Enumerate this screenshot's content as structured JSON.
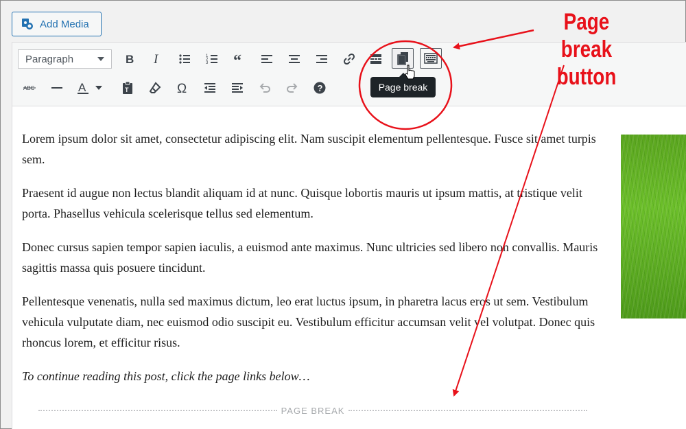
{
  "add_media": {
    "label": "Add Media",
    "icon": "media-icon"
  },
  "toolbar": {
    "format_select": "Paragraph",
    "tooltip": "Page break",
    "row1": [
      "bold-icon",
      "italic-icon",
      "bullet-list-icon",
      "numbered-list-icon",
      "blockquote-icon",
      "align-left-icon",
      "align-center-icon",
      "align-right-icon",
      "link-icon",
      "read-more-icon",
      "page-break-icon",
      "toolbar-toggle-icon"
    ],
    "row2": [
      "strikethrough-icon",
      "horizontal-line-icon",
      "text-color-icon",
      "paste-text-icon",
      "clear-formatting-icon",
      "special-character-icon",
      "outdent-icon",
      "indent-icon",
      "undo-icon",
      "redo-icon",
      "help-icon"
    ],
    "strike_label": "ABC",
    "color_label": "A",
    "omega_label": "Ω"
  },
  "content": {
    "p1": "Lorem ipsum dolor sit amet, consectetur adipiscing elit. Nam suscipit elementum pellentesque. Fusce sit amet turpis sem.",
    "p2": "Praesent id augue non lectus blandit aliquam id at nunc. Quisque lobortis mauris ut ipsum mattis, at tristique velit porta. Phasellus vehicula scelerisque tellus sed elementum.",
    "p3": "Donec cursus sapien tempor sapien iaculis, a euismod ante maximus. Nunc ultricies sed libero non convallis. Mauris sagittis massa quis posuere tincidunt.",
    "p4": "Pellentesque venenatis, nulla sed maximus dictum, leo erat luctus ipsum, in pharetra lacus eros ut sem. Vestibulum vehicula vulputate diam, nec euismod odio suscipit eu. Vestibulum efficitur accumsan velit vel volutpat. Donec quis rhoncus lorem, et efficitur risus.",
    "p5": "To continue reading this post, click the page links below…",
    "page_break": "PAGE BREAK"
  },
  "annotation": {
    "line1": "Page break",
    "line2": "button",
    "color": "#e8111a"
  }
}
